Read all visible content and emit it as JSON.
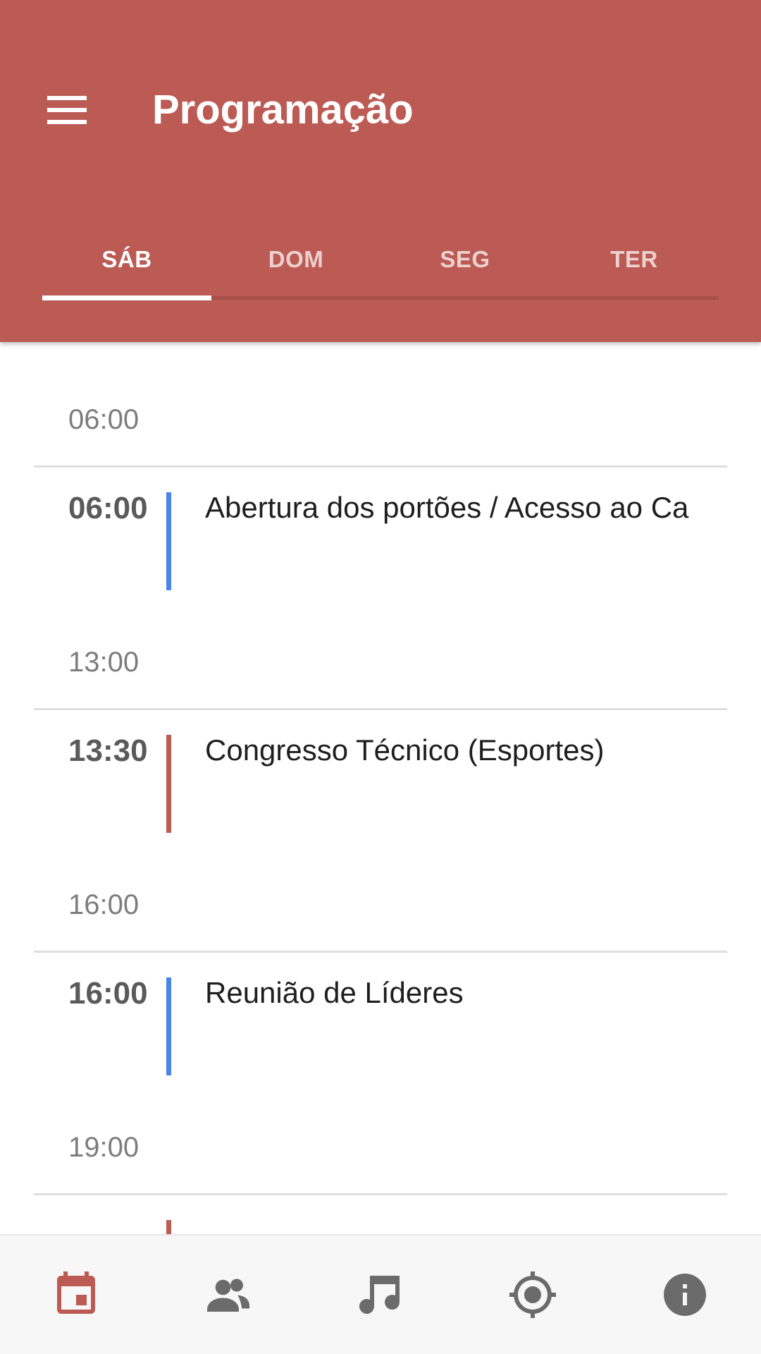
{
  "appbar": {
    "title": "Programação",
    "menu_icon": "menu-icon",
    "color": "#bc5a54"
  },
  "tabs": [
    {
      "label": "SÁB",
      "active": true
    },
    {
      "label": "DOM",
      "active": false
    },
    {
      "label": "SEG",
      "active": false
    },
    {
      "label": "TER",
      "active": false
    }
  ],
  "schedule": [
    {
      "group_hour": "06:00",
      "events": [
        {
          "time": "06:00",
          "title": "Abertura dos portões / Acesso ao Ca",
          "color": "#4a86e8"
        }
      ]
    },
    {
      "group_hour": "13:00",
      "events": [
        {
          "time": "13:30",
          "title": "Congresso Técnico (Esportes)",
          "color": "#bc5a54"
        }
      ]
    },
    {
      "group_hour": "16:00",
      "events": [
        {
          "time": "16:00",
          "title": "Reunião de Líderes",
          "color": "#4a86e8"
        }
      ]
    },
    {
      "group_hour": "19:00",
      "events": [
        {
          "time": "",
          "title": "",
          "color": "#bc5a54"
        }
      ]
    }
  ],
  "bottom_nav": [
    {
      "name": "calendar-icon",
      "active": true
    },
    {
      "name": "people-icon",
      "active": false
    },
    {
      "name": "music-note-icon",
      "active": false
    },
    {
      "name": "location-target-icon",
      "active": false
    },
    {
      "name": "info-icon",
      "active": false
    }
  ],
  "colors": {
    "accent": "#bc5a54",
    "blue": "#4a86e8",
    "nav_inactive": "#6b6b6b"
  }
}
